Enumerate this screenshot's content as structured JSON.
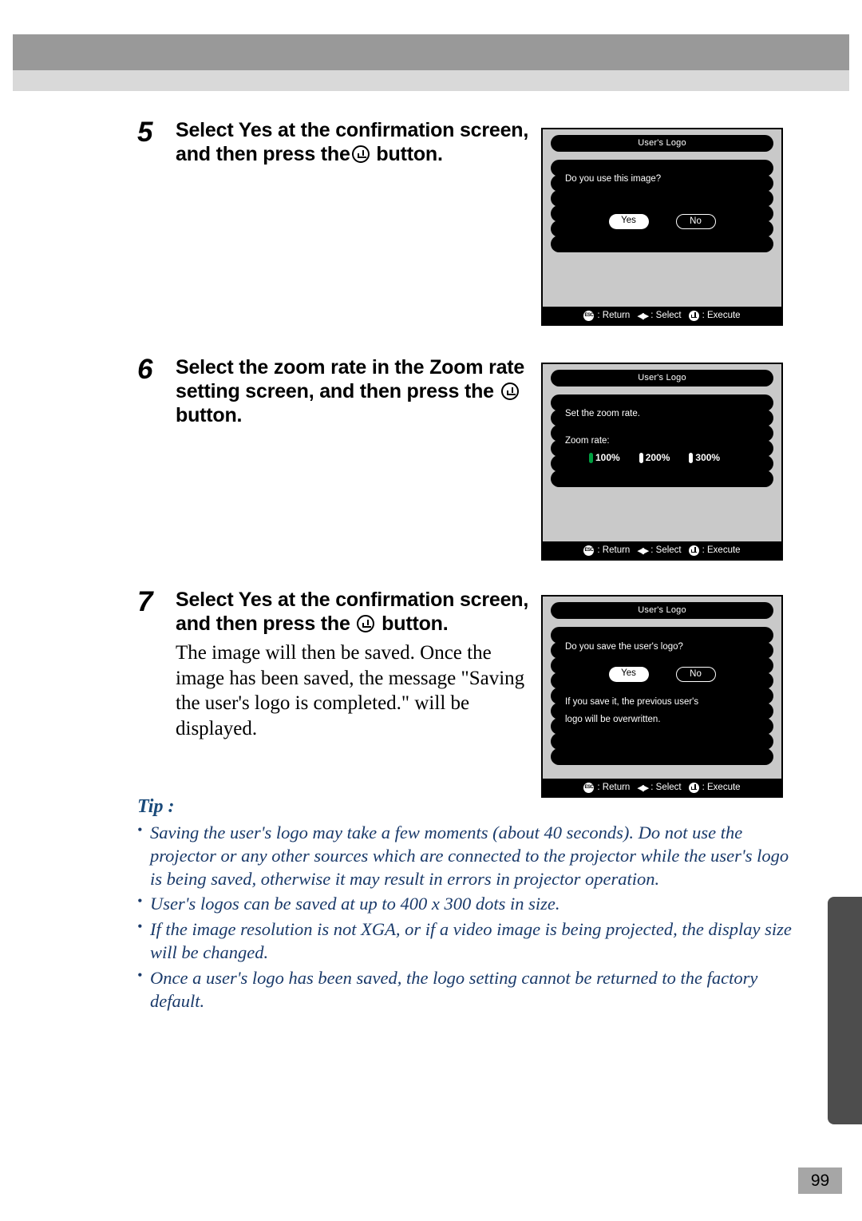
{
  "page": {
    "number": "99"
  },
  "steps": [
    {
      "num": "5",
      "heading_before": "Select Yes at the confirmation screen, and then press the",
      "heading_after": "button.",
      "body": ""
    },
    {
      "num": "6",
      "heading_before": "Select the zoom rate in the Zoom rate setting screen, and then press the",
      "heading_after": "button.",
      "body": ""
    },
    {
      "num": "7",
      "heading_before": "Select Yes at the confirmation screen, and then press the",
      "heading_after": "button.",
      "body": "The image will then be saved. Once the image has been saved, the message \"Saving the user's logo is completed.\" will be displayed."
    }
  ],
  "screens": [
    {
      "title": "User's Logo",
      "message": "Do you use this image?",
      "buttons": [
        {
          "label": "Yes",
          "selected": true
        },
        {
          "label": "No",
          "selected": false
        }
      ],
      "footer": [
        {
          "icon": "esc-icon",
          "label": ": Return"
        },
        {
          "icon": "left-right-arrow-icon",
          "label": ": Select"
        },
        {
          "icon": "enter-icon",
          "label": ": Execute"
        }
      ]
    },
    {
      "title": "User's Logo",
      "message": "Set the zoom rate.",
      "field_label": "Zoom rate:",
      "options": [
        {
          "label": "100%",
          "selected": true
        },
        {
          "label": "200%",
          "selected": false
        },
        {
          "label": "300%",
          "selected": false
        }
      ],
      "footer": [
        {
          "icon": "esc-icon",
          "label": ": Return"
        },
        {
          "icon": "left-right-arrow-icon",
          "label": ": Select"
        },
        {
          "icon": "enter-icon",
          "label": ": Execute"
        }
      ]
    },
    {
      "title": "User's Logo",
      "message": "Do you save the user's logo?",
      "buttons": [
        {
          "label": "Yes",
          "selected": true
        },
        {
          "label": "No",
          "selected": false
        }
      ],
      "note_line1": "If you save it, the previous user's",
      "note_line2": "logo will be overwritten.",
      "footer": [
        {
          "icon": "esc-icon",
          "label": ": Return"
        },
        {
          "icon": "left-right-arrow-icon",
          "label": ": Select"
        },
        {
          "icon": "enter-icon",
          "label": ": Execute"
        }
      ]
    }
  ],
  "tip": {
    "title": "Tip :",
    "items": [
      "Saving the user's logo may take a few moments (about 40 seconds). Do not use the projector or any other sources which are connected to the projector while the user's logo is being saved, otherwise it may result in errors in projector operation.",
      "User's logos can be saved at up to 400 x 300 dots in size.",
      "If the image resolution is not XGA, or if a video image is being projected, the display size will be changed.",
      "Once a user's logo has been saved, the logo setting cannot be returned to the factory default."
    ]
  },
  "colors": {
    "header_dark": "#999999",
    "header_light": "#d9d9d9",
    "side_tab": "#4d4d4d",
    "page_box": "#a6a6a6",
    "screen_bg": "#c9c9c9",
    "selected_radio": "#00a040",
    "tip_text": "#1a3a6a"
  }
}
